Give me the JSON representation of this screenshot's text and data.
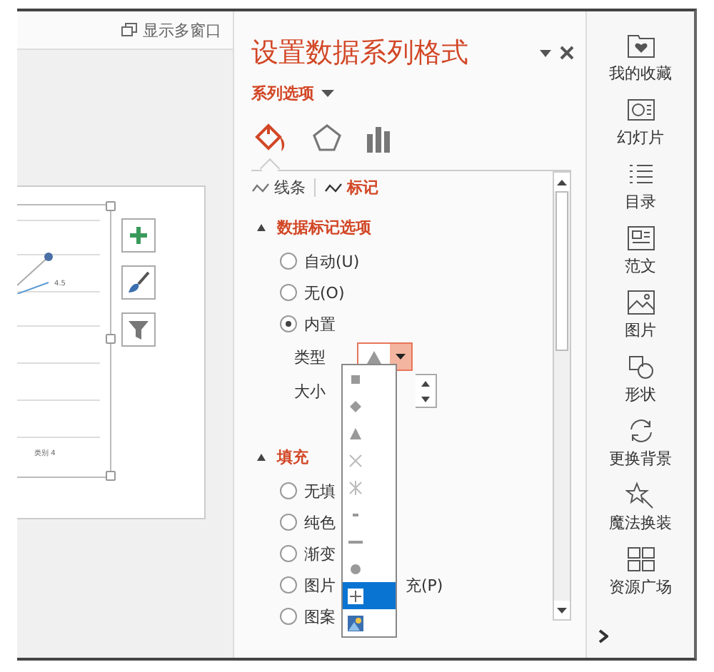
{
  "left_panel": {
    "multi_window_label": "显示多窗口",
    "chart": {
      "data_label": "4.5",
      "category_label": "类别 4"
    }
  },
  "pane": {
    "title": "设置数据系列格式",
    "options_menu": "系列选项",
    "category_tabs": [
      {
        "kind": "fill",
        "selected": true
      },
      {
        "kind": "effects",
        "selected": false
      },
      {
        "kind": "series",
        "selected": false
      }
    ],
    "subtabs": [
      {
        "label": "线条",
        "selected": false
      },
      {
        "label": "标记",
        "selected": true
      }
    ],
    "marker_section": {
      "title": "数据标记选项",
      "expanded": true,
      "options": [
        {
          "label": "自动(U)",
          "selected": false
        },
        {
          "label": "无(O)",
          "selected": false
        },
        {
          "label": "内置",
          "selected": true
        }
      ],
      "type_label": "类型",
      "size_label": "大小"
    },
    "fill_section": {
      "title": "填充",
      "expanded": true,
      "options": [
        {
          "label": "无填",
          "selected": false
        },
        {
          "label": "纯色",
          "selected": false
        },
        {
          "label": "渐变",
          "selected": false
        },
        {
          "label": "图片",
          "label_after": "充(P)",
          "selected": false
        },
        {
          "label": "图案",
          "selected": false
        }
      ]
    },
    "marker_type_menu": {
      "open": true,
      "items": [
        {
          "kind": "square",
          "selected": false
        },
        {
          "kind": "diamond",
          "selected": false
        },
        {
          "kind": "triangle",
          "selected": false
        },
        {
          "kind": "x",
          "selected": false
        },
        {
          "kind": "star",
          "selected": false
        },
        {
          "kind": "short-dash",
          "selected": false
        },
        {
          "kind": "long-dash",
          "selected": false
        },
        {
          "kind": "circle",
          "selected": false
        },
        {
          "kind": "plus",
          "selected": true
        },
        {
          "kind": "picture",
          "selected": false
        }
      ]
    }
  },
  "sidebar": {
    "items": [
      {
        "kind": "favorites",
        "label": "我的收藏"
      },
      {
        "kind": "slides",
        "label": "幻灯片"
      },
      {
        "kind": "outline",
        "label": "目录"
      },
      {
        "kind": "document",
        "label": "范文"
      },
      {
        "kind": "image",
        "label": "图片"
      },
      {
        "kind": "shape",
        "label": "形状"
      },
      {
        "kind": "refresh",
        "label": "更换背景"
      },
      {
        "kind": "magic",
        "label": "魔法换装"
      },
      {
        "kind": "grid",
        "label": "资源广场"
      }
    ]
  }
}
